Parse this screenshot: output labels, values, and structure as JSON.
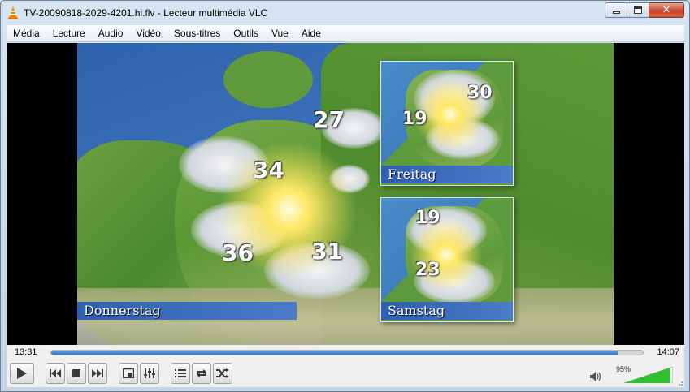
{
  "window": {
    "title": "TV-20090818-2029-4201.hi.flv - Lecteur multimédia VLC",
    "controls": [
      "minimize",
      "maximize",
      "close"
    ]
  },
  "menu": [
    "Média",
    "Lecture",
    "Audio",
    "Vidéo",
    "Sous-titres",
    "Outils",
    "Vue",
    "Aide"
  ],
  "video": {
    "main": {
      "day": "Donnerstag",
      "temps": [
        "27",
        "34",
        "36",
        "31"
      ]
    },
    "inset_top": {
      "day": "Freitag",
      "temps": [
        "19",
        "30"
      ]
    },
    "inset_bottom": {
      "day": "Samstag",
      "temps": [
        "19",
        "23"
      ]
    }
  },
  "playback": {
    "current_time": "13:31",
    "total_time": "14:07",
    "progress": 0.958
  },
  "volume": {
    "label": "95%",
    "level": 0.95
  },
  "icons": {
    "play": "play-icon",
    "prev": "previous-icon",
    "stop": "stop-icon",
    "next": "next-icon",
    "fullscreen": "fullscreen-icon",
    "extended": "equalizer-icon",
    "playlist": "playlist-icon",
    "loop": "loop-icon",
    "random": "shuffle-icon",
    "volume": "speaker-icon"
  },
  "colors": {
    "accent": "#2d77c8",
    "volume_green": "#2fbf2f",
    "sea": "#2f62ac",
    "strip": "#2f5fb0"
  }
}
